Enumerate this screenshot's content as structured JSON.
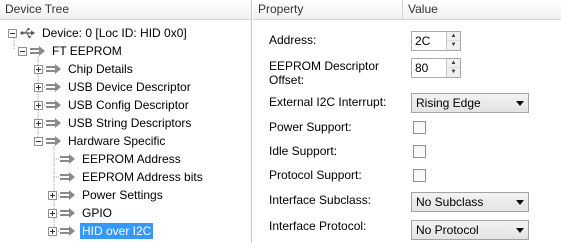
{
  "tree": {
    "header": "Device Tree",
    "nodes": [
      {
        "label": "Device: 0 [Loc ID: HID 0x0]",
        "icon": "usb-icon",
        "expander": "minus"
      },
      {
        "label": "FT EEPROM",
        "icon": "arrow-icon",
        "expander": "minus"
      },
      {
        "label": "Chip Details",
        "icon": "arrow-icon",
        "expander": "plus"
      },
      {
        "label": "USB Device Descriptor",
        "icon": "arrow-icon",
        "expander": "plus"
      },
      {
        "label": "USB Config Descriptor",
        "icon": "arrow-icon",
        "expander": "plus"
      },
      {
        "label": "USB String Descriptors",
        "icon": "arrow-icon",
        "expander": "plus"
      },
      {
        "label": "Hardware Specific",
        "icon": "arrow-icon",
        "expander": "minus"
      },
      {
        "label": "EEPROM Address",
        "icon": "arrow-icon",
        "expander": "none"
      },
      {
        "label": "EEPROM Address bits",
        "icon": "arrow-icon",
        "expander": "none"
      },
      {
        "label": "Power Settings",
        "icon": "arrow-icon",
        "expander": "plus"
      },
      {
        "label": "GPIO",
        "icon": "arrow-icon",
        "expander": "plus"
      },
      {
        "label": "HID over I2C",
        "icon": "arrow-icon",
        "expander": "plus",
        "selected": true
      }
    ]
  },
  "grid": {
    "property_header": "Property",
    "value_header": "Value",
    "address": {
      "label": "Address:",
      "value": "2C"
    },
    "eeprom_offset": {
      "label_line1": "EEPROM Descriptor",
      "label_line2": "Offset:",
      "value": "80"
    },
    "ext_interrupt": {
      "label": "External I2C Interrupt:",
      "value": "Rising Edge"
    },
    "power_support": {
      "label": "Power Support:",
      "checked": false
    },
    "idle_support": {
      "label": "Idle Support:",
      "checked": false
    },
    "protocol_support": {
      "label": "Protocol Support:",
      "checked": false
    },
    "interface_subclass": {
      "label": "Interface Subclass:",
      "value": "No Subclass"
    },
    "interface_protocol": {
      "label": "Interface Protocol:",
      "value": "No Protocol"
    }
  },
  "colors": {
    "selection": "#3399ff",
    "tree_lines": "#a0a0a0",
    "arrow_icon": "#8a8a8a"
  }
}
